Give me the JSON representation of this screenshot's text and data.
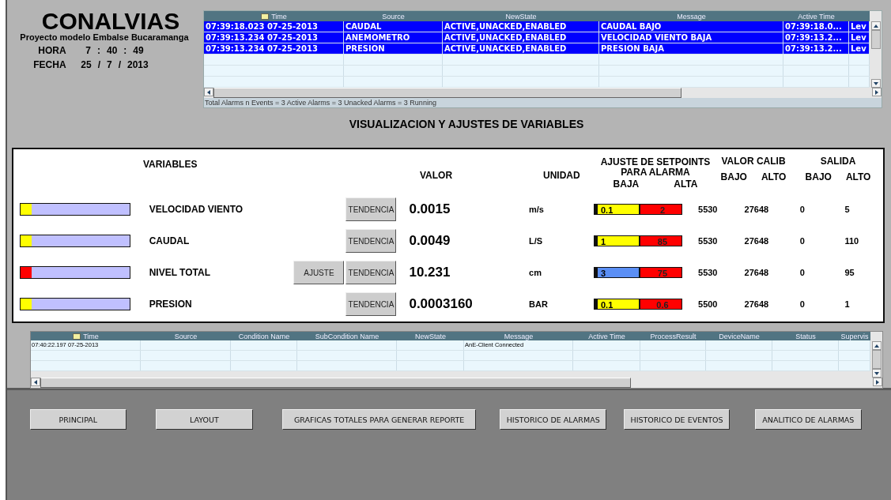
{
  "header": {
    "title": "CONALVIAS",
    "subtitle": "Proyecto modelo Embalse Bucaramanga",
    "time_label": "HORA",
    "time_parts": [
      "7",
      ":",
      "40",
      ":",
      "49"
    ],
    "date_label": "FECHA",
    "date_parts": [
      "25",
      "/",
      "7",
      "/",
      "2013"
    ]
  },
  "alarm_grid": {
    "columns": [
      {
        "label": "Time",
        "sorted": true
      },
      {
        "label": "Source",
        "sorted": false
      },
      {
        "label": "NewState",
        "sorted": false
      },
      {
        "label": "Message",
        "sorted": false
      },
      {
        "label": "Active Time",
        "sorted": false
      }
    ],
    "rows": [
      {
        "selected": true,
        "cells": [
          "07:39:18.023 07-25-2013",
          "CAUDAL",
          "ACTIVE,UNACKED,ENABLED",
          "CAUDAL BAJO",
          "07:39:18.0...",
          "Lev"
        ]
      },
      {
        "selected": true,
        "cells": [
          "07:39:13.234 07-25-2013",
          "ANEMOMETRO",
          "ACTIVE,UNACKED,ENABLED",
          "VELOCIDAD VIENTO BAJA",
          "07:39:13.2...",
          "Lev"
        ]
      },
      {
        "selected": true,
        "cells": [
          "07:39:13.234 07-25-2013",
          "PRESION",
          "ACTIVE,UNACKED,ENABLED",
          "PRESION BAJA",
          "07:39:13.2...",
          "Lev"
        ]
      }
    ],
    "status": "Total Alarms n Events = 3  Active Alarms = 3  Unacked Alarms = 3  Running"
  },
  "section_title": "VISUALIZACION Y AJUSTES DE VARIABLES",
  "variables_panel": {
    "headers": {
      "variables": "VARIABLES",
      "value": "VALOR",
      "unit": "UNIDAD",
      "setpoints_1": "AJUSTE DE SETPOINTS",
      "setpoints_2": "PARA ALARMA",
      "low_alarm": "BAJA",
      "high_alarm": "ALTA",
      "calib": "VALOR CALIB",
      "calib_low": "BAJO",
      "calib_high": "ALTO",
      "output": "SALIDA",
      "output_low": "BAJO",
      "output_high": "ALTO"
    },
    "rows": [
      {
        "name": "VELOCIDAD VIENTO",
        "level": 0.1,
        "color": "#ffff00",
        "trend_button": "TENDENCIA",
        "value": "0.0015",
        "unit": "m/s",
        "setpoint_low": {
          "value": "0.1",
          "color": "#ffff00"
        },
        "setpoint_high": "2",
        "calib_low": "5530",
        "calib_high": "27648",
        "output_low": "0",
        "output_high": "5"
      },
      {
        "name": "CAUDAL",
        "level": 0.1,
        "color": "#ffff00",
        "trend_button": "TENDENCIA",
        "value": "0.0049",
        "unit": "L/S",
        "setpoint_low": {
          "value": "1",
          "color": "#ffff00"
        },
        "setpoint_high": "85",
        "calib_low": "5530",
        "calib_high": "27648",
        "output_low": "0",
        "output_high": "110"
      },
      {
        "name": "NIVEL TOTAL",
        "level": 0.1,
        "color": "#ff0000",
        "adjust_button": "AJUSTE",
        "trend_button": "TENDENCIA",
        "value": "10.231",
        "unit": "cm",
        "setpoint_low": {
          "value": "3",
          "color": "#5b8ff5"
        },
        "setpoint_high": "75",
        "calib_low": "5530",
        "calib_high": "27648",
        "output_low": "0",
        "output_high": "95"
      },
      {
        "name": "PRESION",
        "level": 0.1,
        "color": "#ffff00",
        "trend_button": "TENDENCIA",
        "value": "0.0003160",
        "unit": "BAR",
        "setpoint_low": {
          "value": "0.1",
          "color": "#ffff00"
        },
        "setpoint_high": "0.6",
        "calib_low": "5500",
        "calib_high": "27648",
        "output_low": "0",
        "output_high": "1"
      }
    ]
  },
  "event_grid": {
    "columns": [
      {
        "label": "Time",
        "sorted": true
      },
      {
        "label": "Source",
        "sorted": false
      },
      {
        "label": "Condition Name",
        "sorted": false
      },
      {
        "label": "SubCondition Name",
        "sorted": false
      },
      {
        "label": "NewState",
        "sorted": false
      },
      {
        "label": "Message",
        "sorted": false
      },
      {
        "label": "Active Time",
        "sorted": false
      },
      {
        "label": "ProcessResult",
        "sorted": false
      },
      {
        "label": "DeviceName",
        "sorted": false
      },
      {
        "label": "Status",
        "sorted": false
      },
      {
        "label": "Supervis",
        "sorted": false
      }
    ],
    "rows": [
      {
        "selected": false,
        "time": "07:40:22.197 07-25-2013",
        "message": "AnE-Client Connected"
      }
    ]
  },
  "nav_buttons": [
    "PRINCIPAL",
    "LAYOUT",
    "GRAFICAS TOTALES PARA GENERAR REPORTE",
    "HISTORICO DE ALARMAS",
    "HISTORICO DE EVENTOS",
    "ANALITICO DE ALARMAS"
  ]
}
